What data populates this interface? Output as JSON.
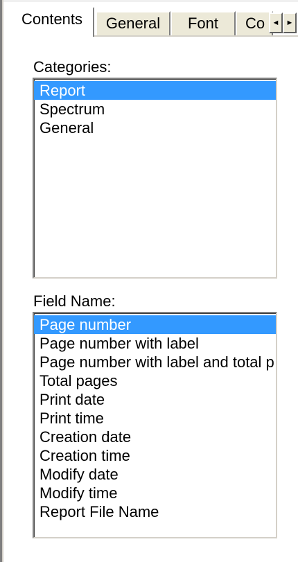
{
  "tabs": [
    {
      "label": "Contents",
      "active": true
    },
    {
      "label": "General",
      "active": false
    },
    {
      "label": "Font",
      "active": false
    },
    {
      "label": "Co",
      "active": false
    }
  ],
  "tab_scroll": {
    "left_glyph": "◄",
    "right_glyph": "►"
  },
  "categories": {
    "label": "Categories:",
    "items": [
      "Report",
      "Spectrum",
      "General"
    ],
    "selected_index": 0
  },
  "field_name": {
    "label": "Field Name:",
    "items": [
      "Page number",
      "Page number with label",
      "Page number with label and total p",
      "Total pages",
      "Print date",
      "Print time",
      "Creation date",
      "Creation time",
      "Modify date",
      "Modify time",
      "Report File Name"
    ],
    "selected_index": 0
  },
  "colors": {
    "selection": "#3399ff",
    "face": "#ece9d8"
  }
}
